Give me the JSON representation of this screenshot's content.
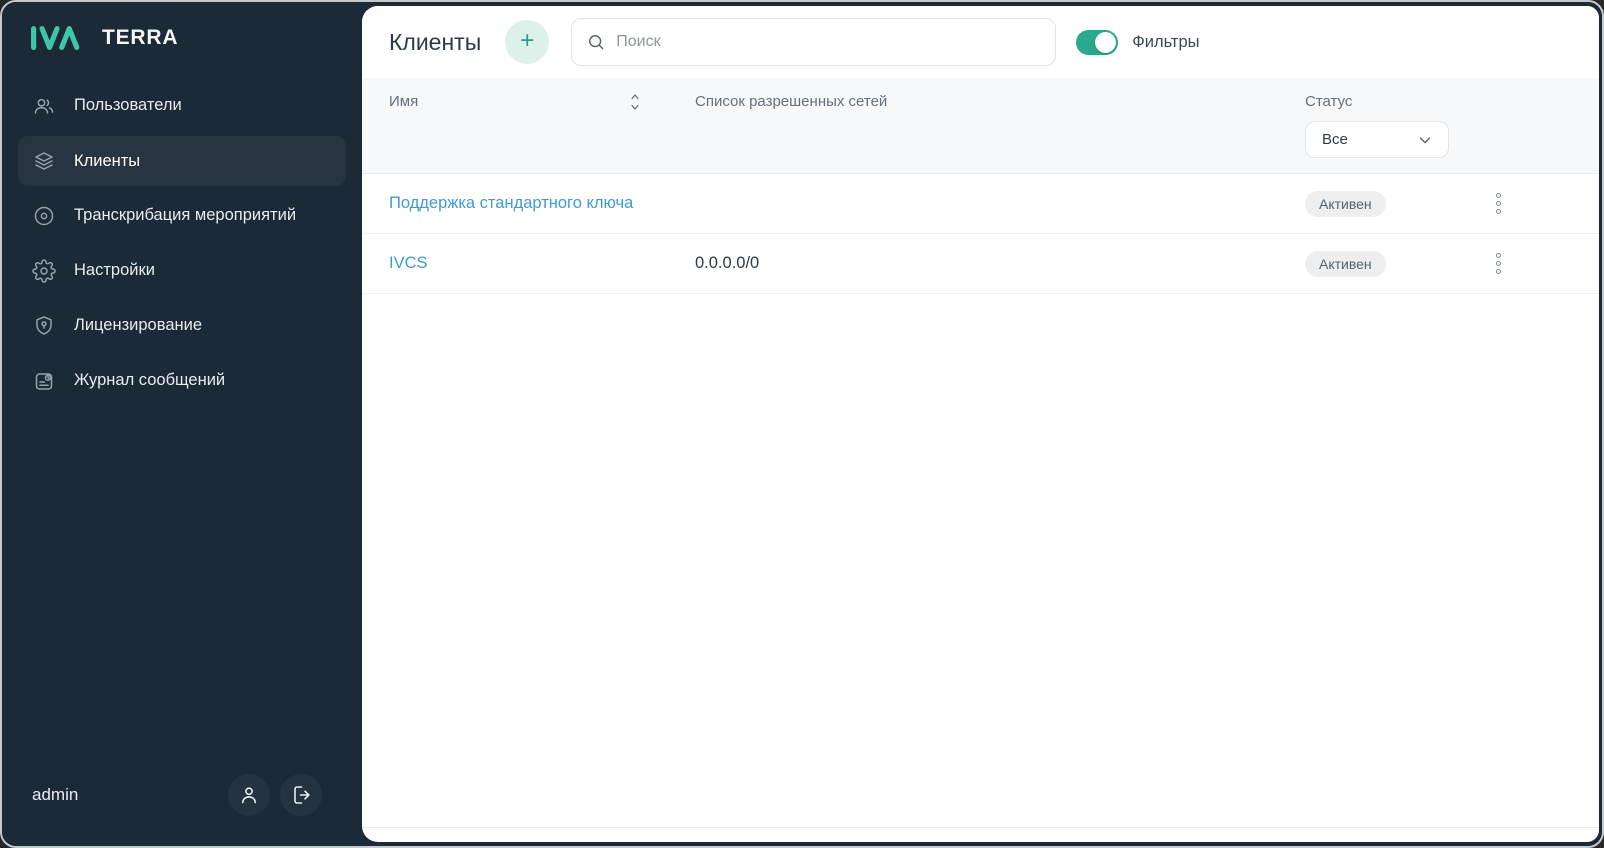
{
  "sidebar": {
    "logo": {
      "brand": "IVA",
      "product": "TERRA"
    },
    "items": [
      {
        "label": "Пользователи",
        "icon": "users-icon",
        "active": false
      },
      {
        "label": "Клиенты",
        "icon": "layers-icon",
        "active": true
      },
      {
        "label": "Транскрибация мероприятий",
        "icon": "record-icon",
        "active": false
      },
      {
        "label": "Настройки",
        "icon": "gear-icon",
        "active": false
      },
      {
        "label": "Лицензирование",
        "icon": "license-shield-icon",
        "active": false
      },
      {
        "label": "Журнал сообщений",
        "icon": "message-journal-icon",
        "active": false
      }
    ],
    "footer": {
      "username": "admin"
    }
  },
  "header": {
    "title": "Клиенты",
    "add_label": "+",
    "search_placeholder": "Поиск",
    "filters_label": "Фильтры",
    "filters_on": true
  },
  "table": {
    "columns": {
      "name": "Имя",
      "networks": "Список разрешенных сетей",
      "status": "Статус"
    },
    "status_filter": {
      "value": "Все"
    },
    "rows": [
      {
        "name": "Поддержка стандартного ключа",
        "networks": "",
        "status": "Активен"
      },
      {
        "name": "IVCS",
        "networks": "0.0.0.0/0",
        "status": "Активен"
      }
    ]
  },
  "colors": {
    "sidebar_bg": "#1c2936",
    "sidebar_active_bg": "#28343f",
    "accent_teal": "#2ba98c",
    "logo_teal": "#3dc7a6",
    "add_button_bg": "#ddf1ea",
    "link_blue": "#3f9bd3",
    "filter_band_bg": "#f7f8fa",
    "badge_bg": "#eceef0",
    "badge_text": "#55616c"
  }
}
